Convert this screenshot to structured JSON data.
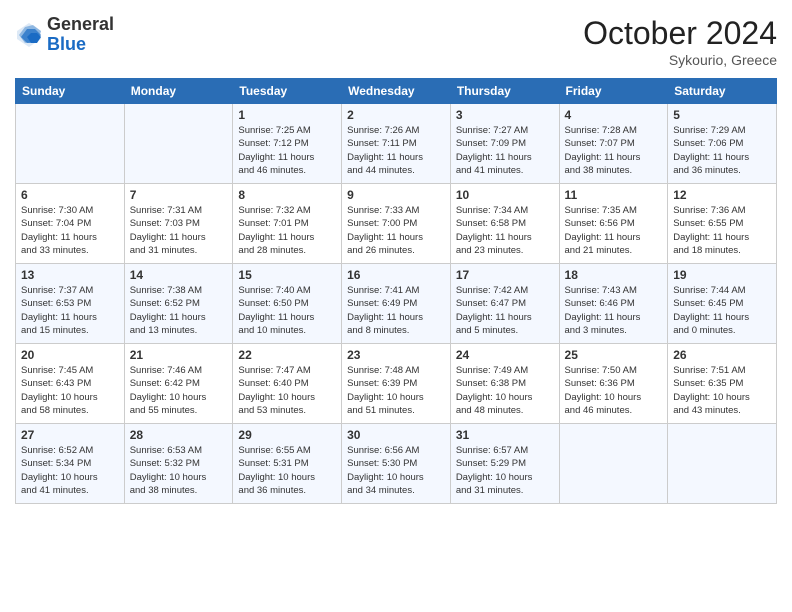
{
  "header": {
    "logo_general": "General",
    "logo_blue": "Blue",
    "month_title": "October 2024",
    "location": "Sykourio, Greece"
  },
  "days_of_week": [
    "Sunday",
    "Monday",
    "Tuesday",
    "Wednesday",
    "Thursday",
    "Friday",
    "Saturday"
  ],
  "weeks": [
    [
      {
        "day": "",
        "info": ""
      },
      {
        "day": "",
        "info": ""
      },
      {
        "day": "1",
        "info": "Sunrise: 7:25 AM\nSunset: 7:12 PM\nDaylight: 11 hours\nand 46 minutes."
      },
      {
        "day": "2",
        "info": "Sunrise: 7:26 AM\nSunset: 7:11 PM\nDaylight: 11 hours\nand 44 minutes."
      },
      {
        "day": "3",
        "info": "Sunrise: 7:27 AM\nSunset: 7:09 PM\nDaylight: 11 hours\nand 41 minutes."
      },
      {
        "day": "4",
        "info": "Sunrise: 7:28 AM\nSunset: 7:07 PM\nDaylight: 11 hours\nand 38 minutes."
      },
      {
        "day": "5",
        "info": "Sunrise: 7:29 AM\nSunset: 7:06 PM\nDaylight: 11 hours\nand 36 minutes."
      }
    ],
    [
      {
        "day": "6",
        "info": "Sunrise: 7:30 AM\nSunset: 7:04 PM\nDaylight: 11 hours\nand 33 minutes."
      },
      {
        "day": "7",
        "info": "Sunrise: 7:31 AM\nSunset: 7:03 PM\nDaylight: 11 hours\nand 31 minutes."
      },
      {
        "day": "8",
        "info": "Sunrise: 7:32 AM\nSunset: 7:01 PM\nDaylight: 11 hours\nand 28 minutes."
      },
      {
        "day": "9",
        "info": "Sunrise: 7:33 AM\nSunset: 7:00 PM\nDaylight: 11 hours\nand 26 minutes."
      },
      {
        "day": "10",
        "info": "Sunrise: 7:34 AM\nSunset: 6:58 PM\nDaylight: 11 hours\nand 23 minutes."
      },
      {
        "day": "11",
        "info": "Sunrise: 7:35 AM\nSunset: 6:56 PM\nDaylight: 11 hours\nand 21 minutes."
      },
      {
        "day": "12",
        "info": "Sunrise: 7:36 AM\nSunset: 6:55 PM\nDaylight: 11 hours\nand 18 minutes."
      }
    ],
    [
      {
        "day": "13",
        "info": "Sunrise: 7:37 AM\nSunset: 6:53 PM\nDaylight: 11 hours\nand 15 minutes."
      },
      {
        "day": "14",
        "info": "Sunrise: 7:38 AM\nSunset: 6:52 PM\nDaylight: 11 hours\nand 13 minutes."
      },
      {
        "day": "15",
        "info": "Sunrise: 7:40 AM\nSunset: 6:50 PM\nDaylight: 11 hours\nand 10 minutes."
      },
      {
        "day": "16",
        "info": "Sunrise: 7:41 AM\nSunset: 6:49 PM\nDaylight: 11 hours\nand 8 minutes."
      },
      {
        "day": "17",
        "info": "Sunrise: 7:42 AM\nSunset: 6:47 PM\nDaylight: 11 hours\nand 5 minutes."
      },
      {
        "day": "18",
        "info": "Sunrise: 7:43 AM\nSunset: 6:46 PM\nDaylight: 11 hours\nand 3 minutes."
      },
      {
        "day": "19",
        "info": "Sunrise: 7:44 AM\nSunset: 6:45 PM\nDaylight: 11 hours\nand 0 minutes."
      }
    ],
    [
      {
        "day": "20",
        "info": "Sunrise: 7:45 AM\nSunset: 6:43 PM\nDaylight: 10 hours\nand 58 minutes."
      },
      {
        "day": "21",
        "info": "Sunrise: 7:46 AM\nSunset: 6:42 PM\nDaylight: 10 hours\nand 55 minutes."
      },
      {
        "day": "22",
        "info": "Sunrise: 7:47 AM\nSunset: 6:40 PM\nDaylight: 10 hours\nand 53 minutes."
      },
      {
        "day": "23",
        "info": "Sunrise: 7:48 AM\nSunset: 6:39 PM\nDaylight: 10 hours\nand 51 minutes."
      },
      {
        "day": "24",
        "info": "Sunrise: 7:49 AM\nSunset: 6:38 PM\nDaylight: 10 hours\nand 48 minutes."
      },
      {
        "day": "25",
        "info": "Sunrise: 7:50 AM\nSunset: 6:36 PM\nDaylight: 10 hours\nand 46 minutes."
      },
      {
        "day": "26",
        "info": "Sunrise: 7:51 AM\nSunset: 6:35 PM\nDaylight: 10 hours\nand 43 minutes."
      }
    ],
    [
      {
        "day": "27",
        "info": "Sunrise: 6:52 AM\nSunset: 5:34 PM\nDaylight: 10 hours\nand 41 minutes."
      },
      {
        "day": "28",
        "info": "Sunrise: 6:53 AM\nSunset: 5:32 PM\nDaylight: 10 hours\nand 38 minutes."
      },
      {
        "day": "29",
        "info": "Sunrise: 6:55 AM\nSunset: 5:31 PM\nDaylight: 10 hours\nand 36 minutes."
      },
      {
        "day": "30",
        "info": "Sunrise: 6:56 AM\nSunset: 5:30 PM\nDaylight: 10 hours\nand 34 minutes."
      },
      {
        "day": "31",
        "info": "Sunrise: 6:57 AM\nSunset: 5:29 PM\nDaylight: 10 hours\nand 31 minutes."
      },
      {
        "day": "",
        "info": ""
      },
      {
        "day": "",
        "info": ""
      }
    ]
  ]
}
